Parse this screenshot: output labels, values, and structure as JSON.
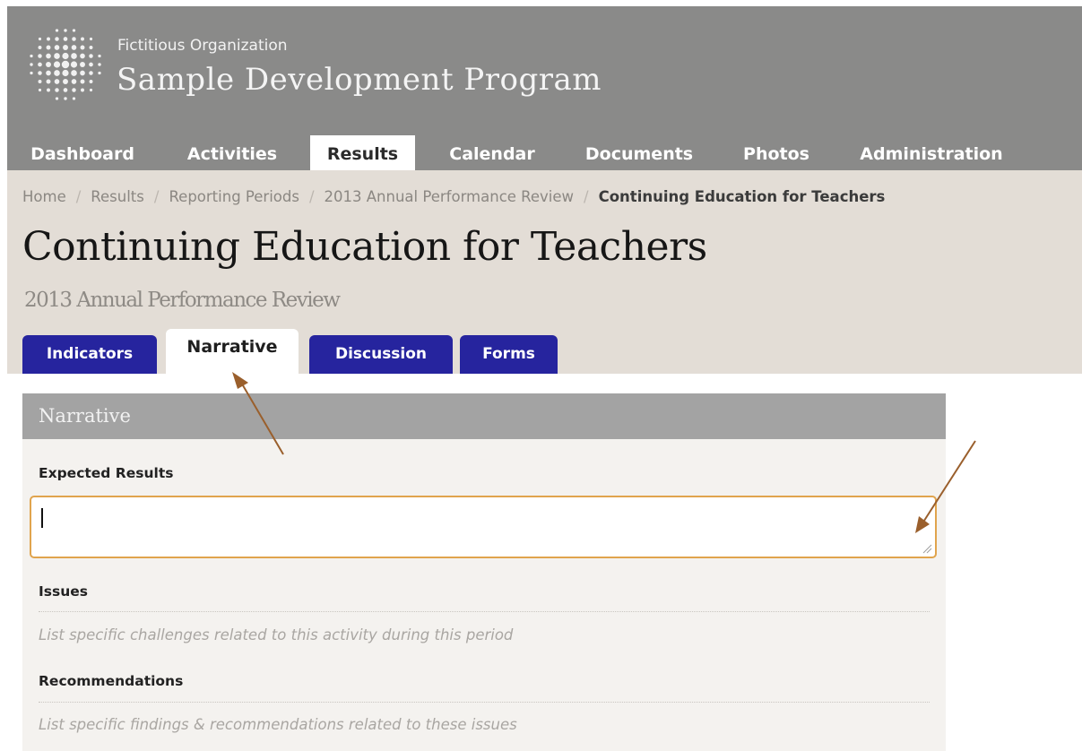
{
  "header": {
    "organization": "Fictitious Organization",
    "program": "Sample Development Program",
    "logo_icon": "dotted-globe-logo"
  },
  "nav": {
    "items": [
      {
        "label": "Dashboard",
        "active": false
      },
      {
        "label": "Activities",
        "active": false
      },
      {
        "label": "Results",
        "active": true
      },
      {
        "label": "Calendar",
        "active": false
      },
      {
        "label": "Documents",
        "active": false
      },
      {
        "label": "Photos",
        "active": false
      },
      {
        "label": "Administration",
        "active": false
      }
    ]
  },
  "breadcrumb": {
    "items": [
      "Home",
      "Results",
      "Reporting Periods",
      "2013 Annual Performance Review"
    ],
    "current": "Continuing Education for Teachers",
    "separator": "/"
  },
  "page": {
    "title": "Continuing Education for Teachers",
    "subtitle": "2013 Annual Performance Review"
  },
  "tabs": [
    {
      "label": "Indicators",
      "active": false
    },
    {
      "label": "Narrative",
      "active": true
    },
    {
      "label": "Discussion",
      "active": false
    },
    {
      "label": "Forms",
      "active": false
    }
  ],
  "panel": {
    "heading": "Narrative",
    "expected_results": {
      "label": "Expected Results",
      "value": ""
    },
    "issues": {
      "label": "Issues",
      "placeholder": "List specific challenges related to this activity during this period"
    },
    "recommendations": {
      "label": "Recommendations",
      "placeholder": "List specific findings & recommendations related to these issues"
    }
  },
  "colors": {
    "header_bg": "#8a8a89",
    "title_band_bg": "#e3ddd6",
    "tab_bg": "#26249e",
    "panel_head_bg": "#a3a3a3",
    "focus_border": "#e0a44d",
    "annotation_arrow": "#9a5f2c"
  }
}
